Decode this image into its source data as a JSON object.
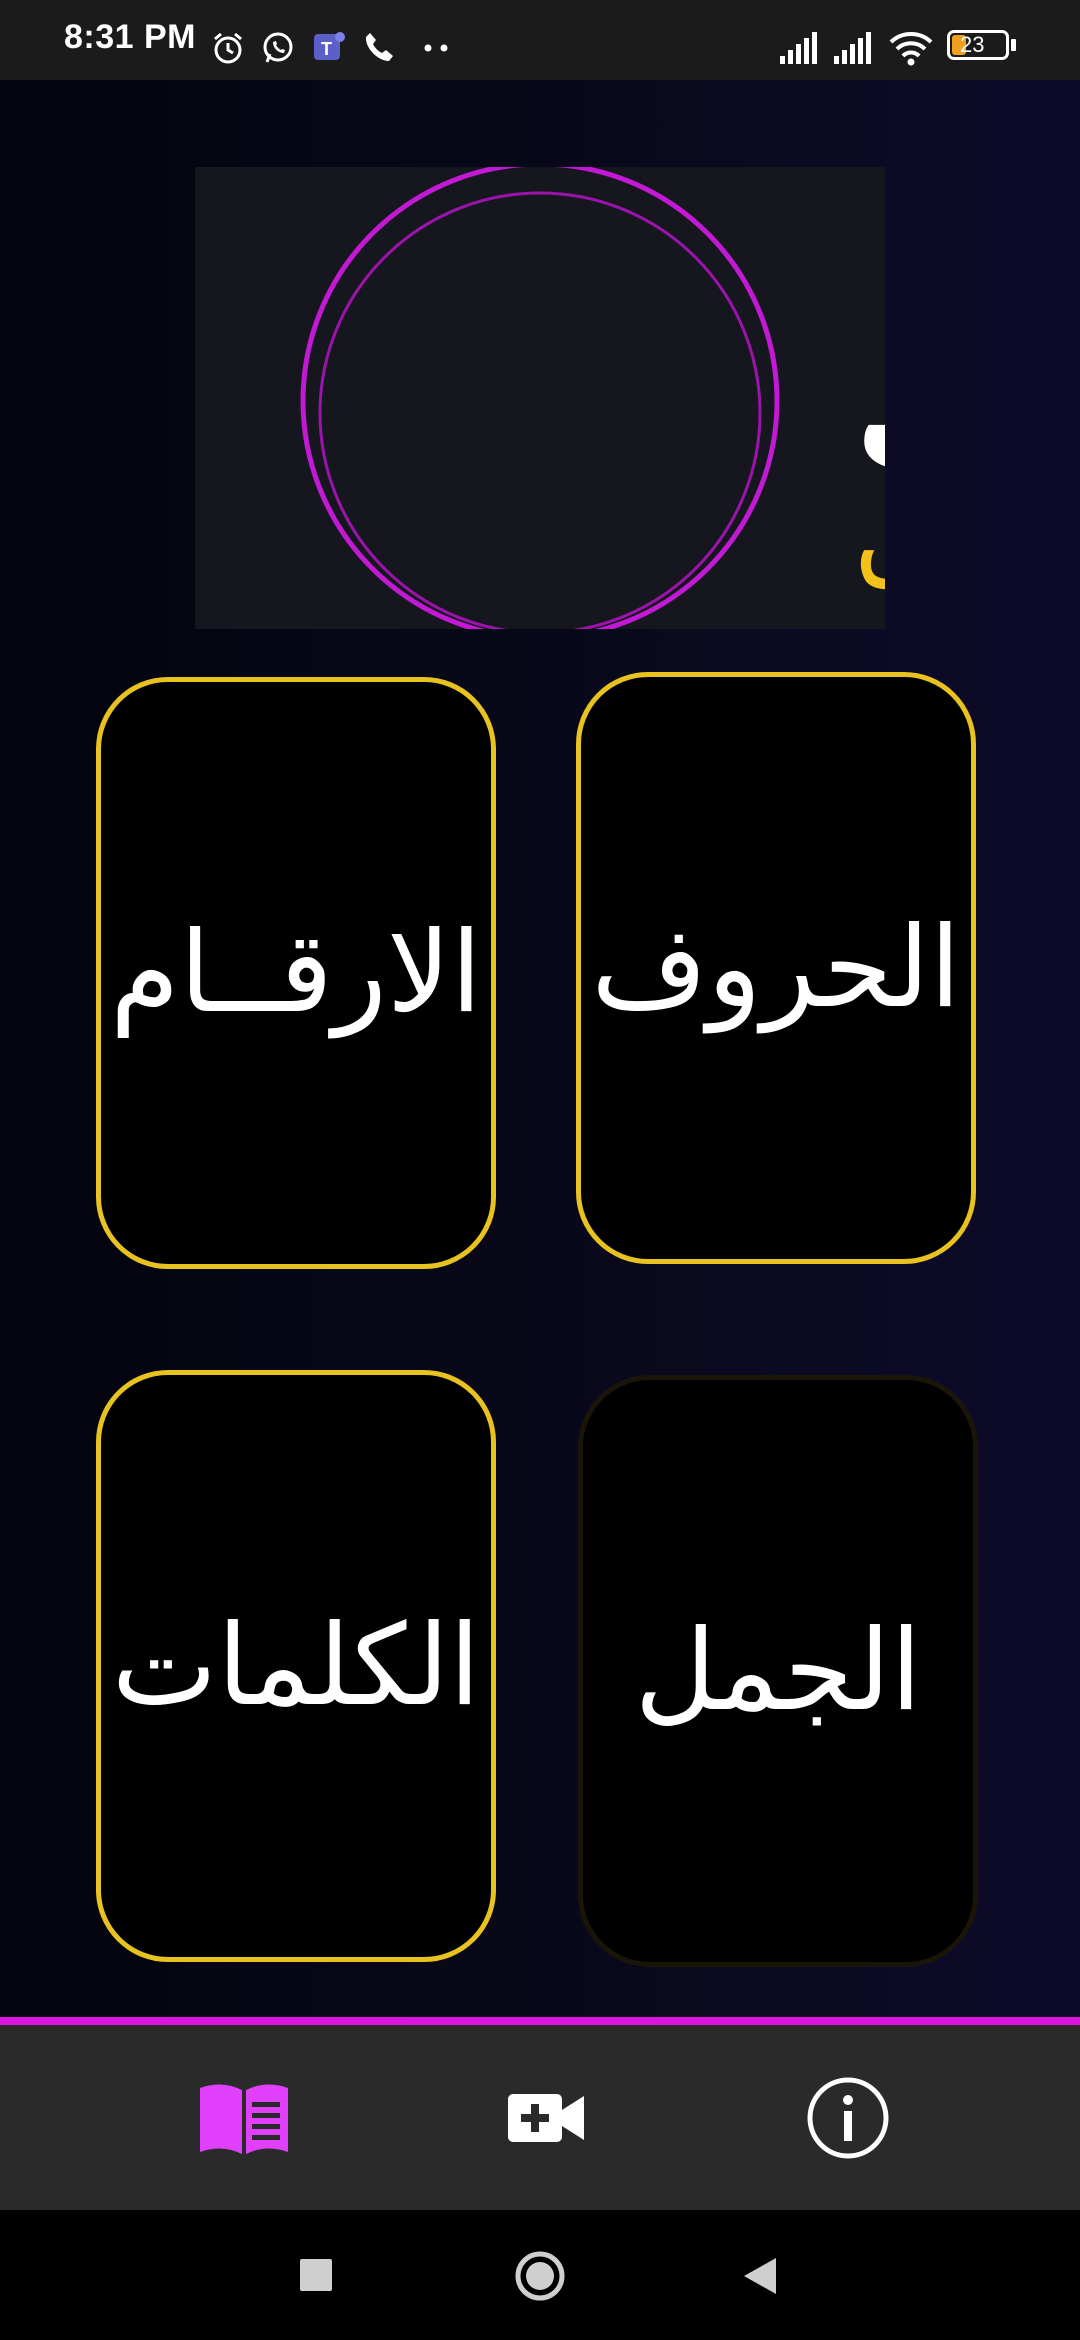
{
  "status_bar": {
    "time": "8:31 PM",
    "battery_level": "23",
    "icons": [
      "alarm-icon",
      "whatsapp-icon",
      "teams-icon",
      "phone-icon",
      "more-dots-icon",
      "signal-icon",
      "signal-icon",
      "wifi-icon",
      "battery-icon"
    ]
  },
  "logo": {
    "line1": "اسمعنـــي",
    "line2": "تطبيـــق",
    "colors": {
      "line1": "#ffffff",
      "line2": "#f2c21b",
      "ring": "#c21ad4"
    }
  },
  "cards": {
    "letters": "الحروف",
    "numbers": "الارقــام",
    "sentences": "الجمل",
    "words": "الكلمات"
  },
  "colors": {
    "accent_gold": "#e8c21e",
    "accent_magenta": "#dd14dd",
    "nav_active": "#e040fb"
  },
  "bottom_nav": {
    "items": [
      {
        "icon": "book-icon",
        "active": true
      },
      {
        "icon": "video-add-icon",
        "active": false
      },
      {
        "icon": "info-icon",
        "active": false
      }
    ]
  },
  "system_nav": [
    "recents-square-icon",
    "home-circle-icon",
    "back-triangle-icon"
  ]
}
